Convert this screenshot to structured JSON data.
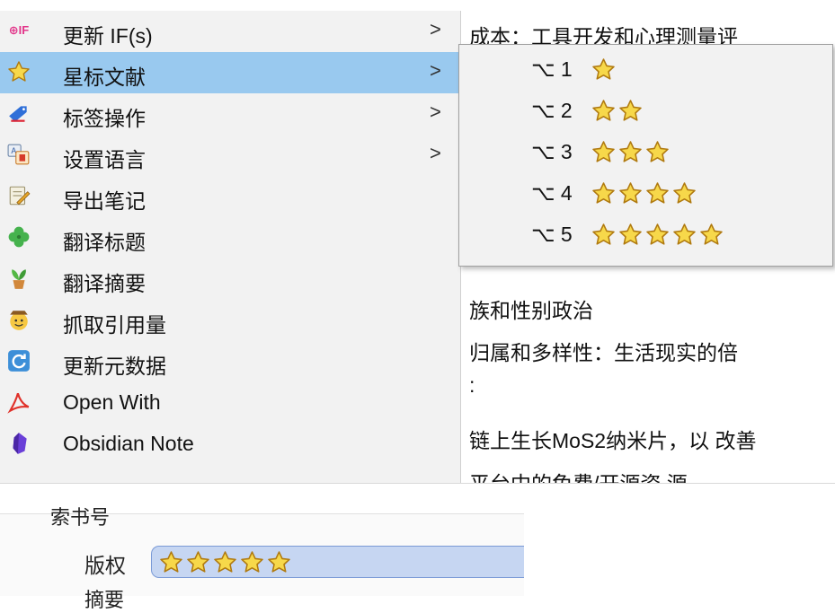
{
  "context_menu": {
    "items": [
      {
        "label": "更新 IF(s)",
        "icon": "if-badge-icon",
        "icon_text": "⊕IF",
        "submenu": true
      },
      {
        "label": "星标文献",
        "icon": "star-icon",
        "submenu": true,
        "highlighted": true
      },
      {
        "label": "标签操作",
        "icon": "tag-pen-icon",
        "submenu": true
      },
      {
        "label": "设置语言",
        "icon": "language-icon",
        "submenu": true
      },
      {
        "label": "导出笔记",
        "icon": "notepad-icon",
        "submenu": false
      },
      {
        "label": "翻译标题",
        "icon": "clover-icon",
        "submenu": false
      },
      {
        "label": "翻译摘要",
        "icon": "plant-icon",
        "submenu": false
      },
      {
        "label": "抓取引用量",
        "icon": "cowboy-icon",
        "submenu": false
      },
      {
        "label": "更新元数据",
        "icon": "refresh-icon",
        "submenu": false
      },
      {
        "label": "Open With",
        "icon": "acrobat-icon",
        "submenu": false
      },
      {
        "label": "Obsidian Note",
        "icon": "obsidian-icon",
        "submenu": false
      }
    ],
    "arrow": ">"
  },
  "rating_submenu": {
    "items": [
      {
        "shortcut": "⌥ 1",
        "stars": 1
      },
      {
        "shortcut": "⌥ 2",
        "stars": 2
      },
      {
        "shortcut": "⌥ 3",
        "stars": 3
      },
      {
        "shortcut": "⌥ 4",
        "stars": 4
      },
      {
        "shortcut": "⌥ 5",
        "stars": 5
      }
    ]
  },
  "background_lines": [
    "成本：工具开发和心理测量评",
    "族和性别政治",
    "归属和多样性：生活现实的倍",
    ":",
    "链上生长MoS2纳米片，以 改善",
    "平台中的免费/开源资 源"
  ],
  "info_panel": {
    "label_cut_top": "索书号",
    "rating_label": "版权",
    "rating_value": 5,
    "label_cut_bottom": "摘要"
  },
  "colors": {
    "menu_bg": "#f2f2f2",
    "highlight": "#99c9ef",
    "star_fill": "#f7d84a",
    "star_stroke": "#b07a10",
    "field_bg": "#c6d6f2"
  }
}
